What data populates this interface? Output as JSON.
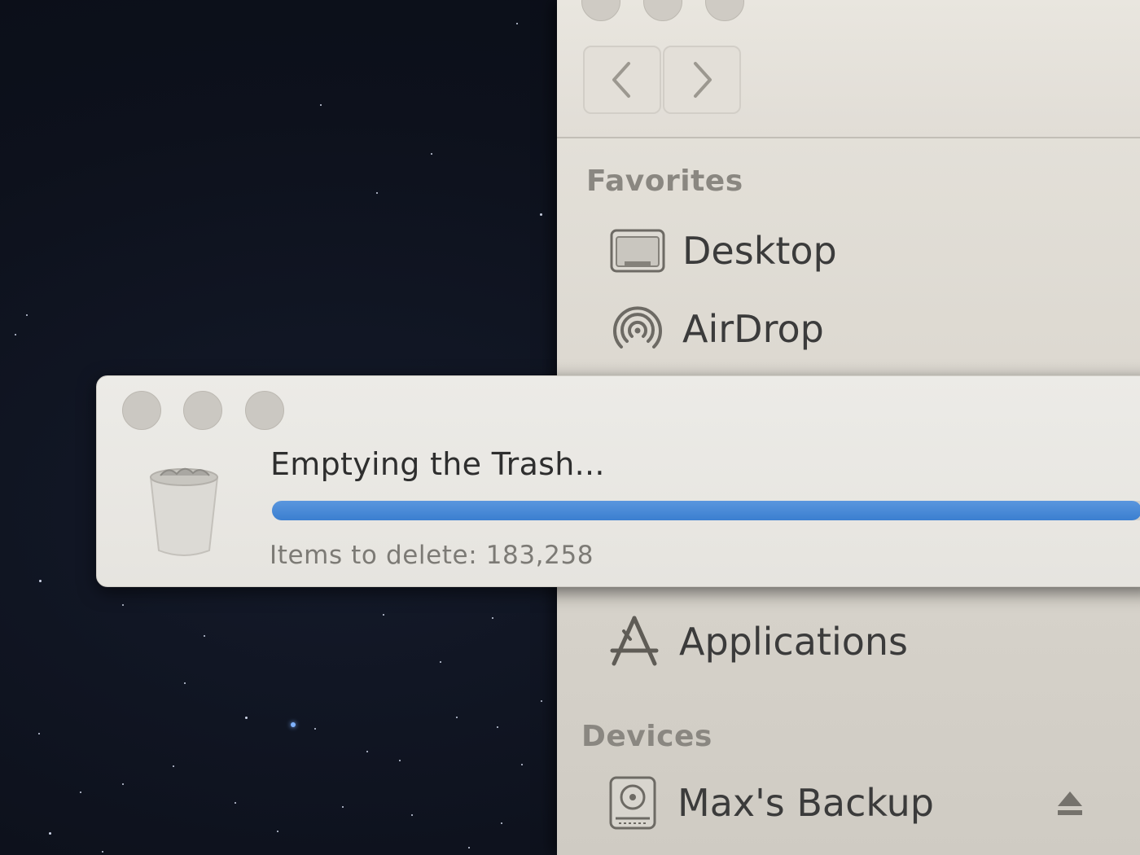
{
  "finder": {
    "sidebar": {
      "favorites_heading": "Favorites",
      "favorites": [
        {
          "label": "Desktop",
          "icon": "desktop-icon"
        },
        {
          "label": "AirDrop",
          "icon": "airdrop-icon"
        },
        {
          "label": "Applications",
          "icon": "applications-icon"
        }
      ],
      "devices_heading": "Devices",
      "devices": [
        {
          "label": "Max's Backup",
          "icon": "drive-icon",
          "eject_icon": "eject-icon"
        }
      ]
    },
    "toolbar": {
      "back_icon": "chevron-left-icon",
      "forward_icon": "chevron-right-icon"
    }
  },
  "dialog": {
    "title": "Emptying the Trash...",
    "status": "Items to delete: 183,258",
    "icon": "trash-icon",
    "progress_fraction": 0.98,
    "progress_color": "#3b7fd0"
  },
  "colors": {
    "desktop_bg": "#0d111c",
    "window_bg": "#e7e4dd",
    "accent": "#3b7fd0"
  }
}
